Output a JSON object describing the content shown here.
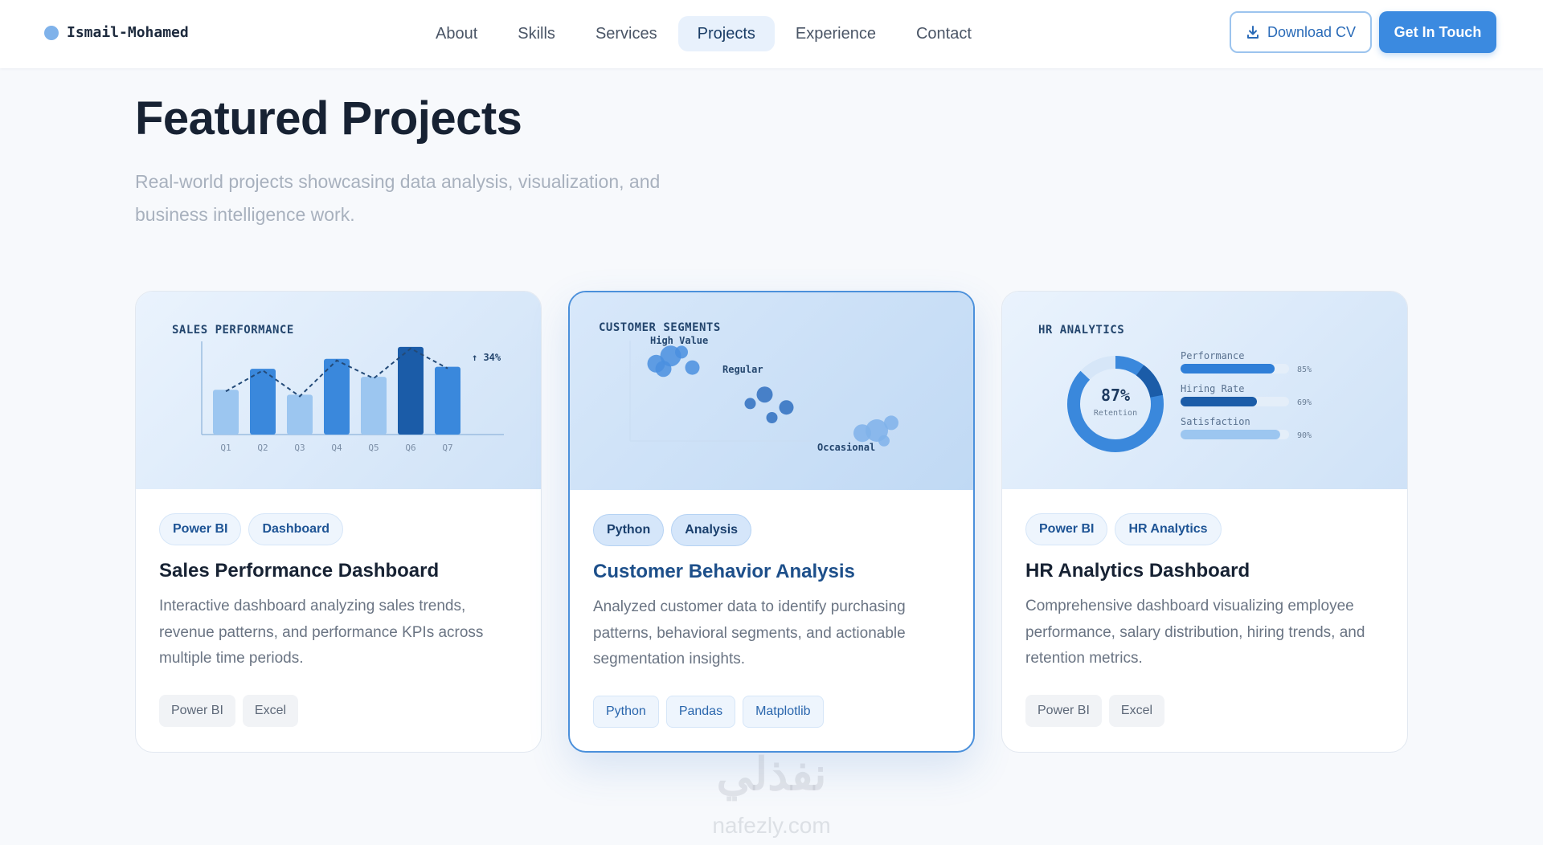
{
  "nav": {
    "brand": "Ismail-Mohamed",
    "links": [
      "About",
      "Skills",
      "Services",
      "Projects",
      "Experience",
      "Contact"
    ],
    "active": "Projects",
    "download_cv": "Download CV",
    "get_in_touch": "Get In Touch"
  },
  "header": {
    "title": "Featured Projects",
    "subtitle": "Real-world projects showcasing data analysis, visualization, and business intelligence work."
  },
  "projects": [
    {
      "visual_title": "SALES PERFORMANCE",
      "visual_badge": "↑ 34%",
      "pills": [
        "Power BI",
        "Dashboard"
      ],
      "title": "Sales Performance Dashboard",
      "description": "Interactive dashboard analyzing sales trends, revenue patterns, and performance KPIs across multiple time periods.",
      "tags": [
        "Power BI",
        "Excel"
      ]
    },
    {
      "visual_title": "CUSTOMER SEGMENTS",
      "pills": [
        "Python",
        "Analysis"
      ],
      "title": "Customer Behavior Analysis",
      "description": "Analyzed customer data to identify purchasing patterns, behavioral segments, and actionable segmentation insights.",
      "tags": [
        "Python",
        "Pandas",
        "Matplotlib"
      ]
    },
    {
      "visual_title": "HR ANALYTICS",
      "pills": [
        "Power BI",
        "HR Analytics"
      ],
      "title": "HR Analytics Dashboard",
      "description": "Comprehensive dashboard visualizing employee performance, salary distribution, hiring trends, and retention metrics.",
      "tags": [
        "Power BI",
        "Excel"
      ]
    }
  ],
  "chart_data": [
    {
      "type": "bar",
      "title": "SALES PERFORMANCE",
      "categories": [
        "Q1",
        "Q2",
        "Q3",
        "Q4",
        "Q5",
        "Q6",
        "Q7"
      ],
      "values": [
        45,
        66,
        40,
        76,
        58,
        88,
        68
      ],
      "ylim": [
        0,
        100
      ],
      "annotation": "↑ 34%"
    },
    {
      "type": "scatter",
      "title": "CUSTOMER SEGMENTS",
      "series": [
        {
          "name": "High Value",
          "points": [
            [
              15,
              82
            ],
            [
              19,
              88
            ],
            [
              22,
              91
            ],
            [
              25,
              79
            ],
            [
              17,
              78
            ]
          ]
        },
        {
          "name": "Regular",
          "points": [
            [
              45,
              58
            ],
            [
              41,
              51
            ],
            [
              51,
              48
            ],
            [
              47,
              40
            ]
          ]
        },
        {
          "name": "Occasional",
          "points": [
            [
              72,
              28
            ],
            [
              76,
              30
            ],
            [
              80,
              36
            ],
            [
              78,
              22
            ]
          ]
        }
      ]
    },
    {
      "type": "bar",
      "title": "HR ANALYTICS",
      "donut": {
        "value": "87%",
        "label": "Retention",
        "fraction": 0.87
      },
      "categories": [
        "Performance",
        "Hiring Rate",
        "Satisfaction"
      ],
      "values": [
        85,
        69,
        90
      ],
      "value_labels": [
        "85%",
        "69%",
        "90%"
      ],
      "colors": [
        "#2f7fd8",
        "#1b5ca8",
        "#9cc6f0"
      ]
    }
  ],
  "watermark": {
    "arabic": "نفذلي",
    "latin": "nafezly.com"
  }
}
